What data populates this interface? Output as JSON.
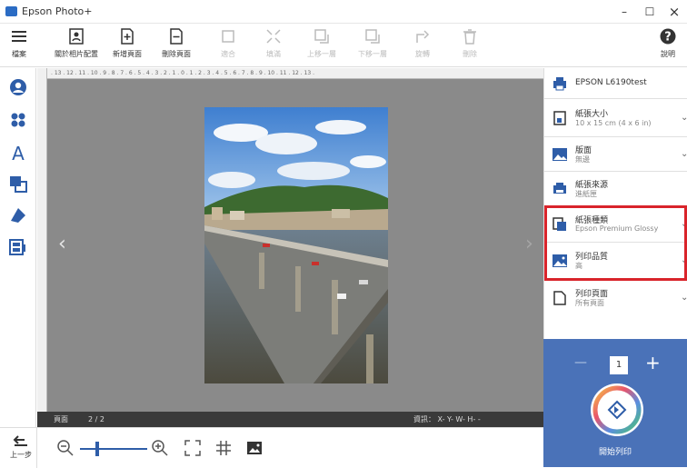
{
  "window": {
    "title": "Epson Photo+",
    "minimize": "–",
    "maximize": "☐",
    "close": "×"
  },
  "toolbar": {
    "menu_label": "檔案",
    "layout_label": "關於相片配置",
    "add_page_label": "新增頁面",
    "delete_page_label": "刪除頁面",
    "disabled_labels": [
      "適合",
      "填滿",
      "上移一層",
      "下移一層",
      "旋轉",
      "刪除"
    ],
    "help_label": "說明"
  },
  "ruler": {
    "ticks": ". 13 . 12 . 11 . 10 . 9 . 8 . 7 . 6 . 5 . 4 . 3 . 2 . 1 . 0 . 1 . 2 . 3 . 4 . 5 . 6 . 7 . 8 . 9 . 10 . 11 . 12 . 13 ."
  },
  "statusbar": {
    "page_label": "頁面",
    "page_value": "2 / 2",
    "info": "資訊： X- Y- W- H- -"
  },
  "bottombar": {
    "undo_label": "上一步",
    "zoom_level": 0.25
  },
  "printer": {
    "name": "EPSON L6190test",
    "items": [
      {
        "label": "紙張大小",
        "value": "10 x 15 cm (4 x 6 in)"
      },
      {
        "label": "版面",
        "value": "無邊"
      },
      {
        "label": "紙張來源",
        "value": "進紙匣"
      },
      {
        "label": "紙張種類",
        "value": "Epson Premium Glossy"
      },
      {
        "label": "列印品質",
        "value": "高"
      },
      {
        "label": "列印頁面",
        "value": "所有頁面"
      }
    ],
    "copies": "1",
    "minus": "—",
    "plus": "+",
    "print_label": "開始列印"
  },
  "colors": {
    "accent_blue": "#4a72b8",
    "highlight_red": "#d9242b"
  }
}
